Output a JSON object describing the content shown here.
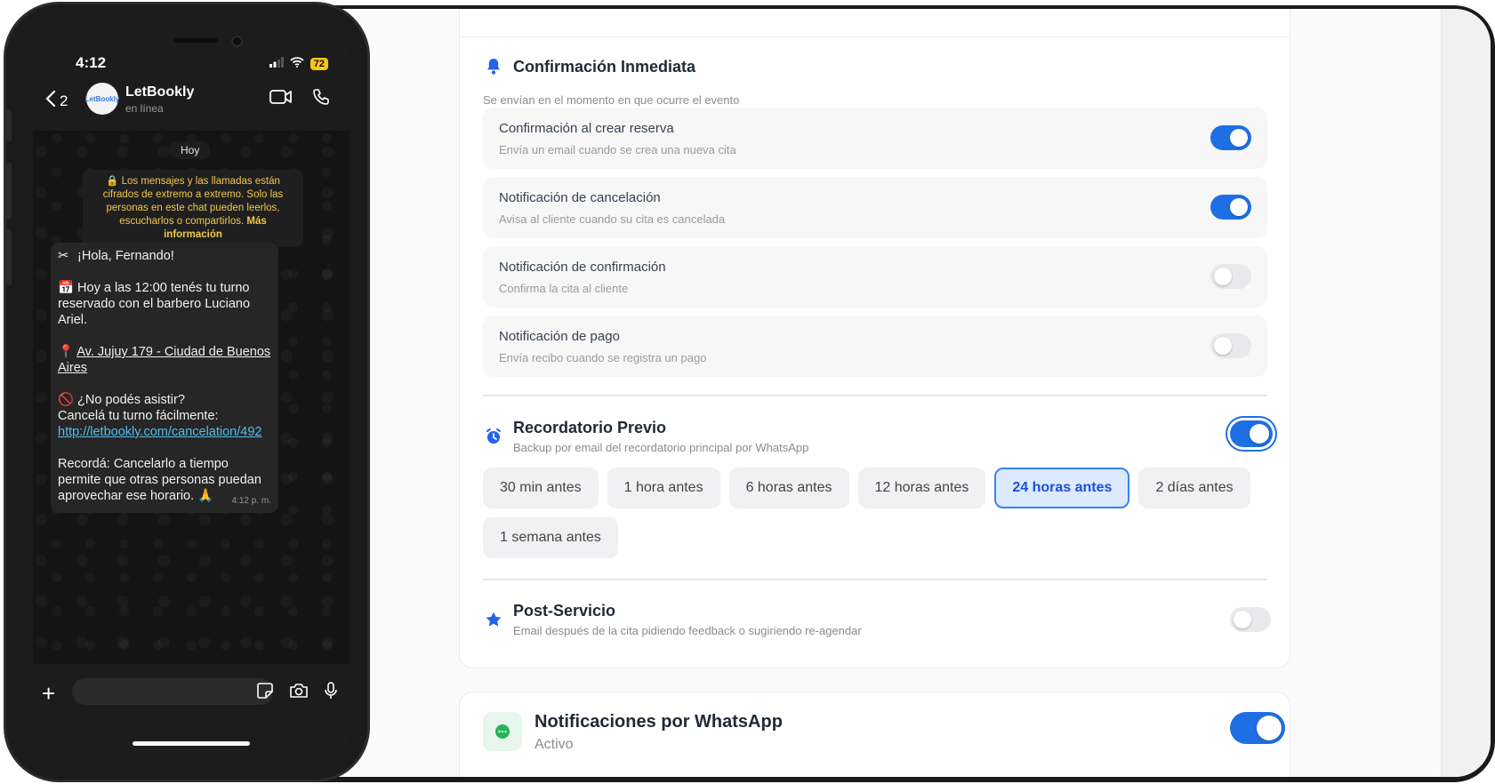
{
  "settings": {
    "immediate": {
      "title": "Confirmación Inmediata",
      "subtitle": "Se envían en el momento en que ocurre el evento",
      "icon": "bell-icon",
      "items": [
        {
          "title": "Confirmación al crear reserva",
          "subtitle": "Envía un email cuando se crea una nueva cita",
          "enabled": true
        },
        {
          "title": "Notificación de cancelación",
          "subtitle": "Avisa al cliente cuando su cita es cancelada",
          "enabled": true
        },
        {
          "title": "Notificación de confirmación",
          "subtitle": "Confirma la cita al cliente",
          "enabled": false
        },
        {
          "title": "Notificación de pago",
          "subtitle": "Envía recibo cuando se registra un pago",
          "enabled": false
        }
      ]
    },
    "reminder": {
      "title": "Recordatorio Previo",
      "subtitle": "Backup por email del recordatorio principal por WhatsApp",
      "icon": "alarm-clock-icon",
      "enabled": true,
      "options": [
        "30 min antes",
        "1 hora antes",
        "6 horas antes",
        "12 horas antes",
        "24 horas antes",
        "2 días antes",
        "1 semana antes"
      ],
      "selected": "24 horas antes"
    },
    "post": {
      "title": "Post-Servicio",
      "subtitle": "Email después de la cita pidiendo feedback o sugiriendo re-agendar",
      "icon": "star-icon",
      "enabled": false
    },
    "whatsapp": {
      "title": "Notificaciones por WhatsApp",
      "status": "Activo",
      "icon": "chat-bubble-icon",
      "enabled": true
    },
    "colors": {
      "accent": "#1e6fe3",
      "chip_selected_bg": "#dbeafe",
      "whatsapp_green": "#25b457"
    }
  },
  "phone": {
    "time": "4:12",
    "battery": "72",
    "back_count": "2",
    "contact_name": "LetBookly",
    "contact_status": "en línea",
    "avatar_text": "LetBookly",
    "day_label": "Hoy",
    "encryption_text": "Los mensajes y las llamadas están cifrados de extremo a extremo. Solo las personas en este chat pueden leerlos, escucharlos o compartirlos.",
    "encryption_link": "Más información",
    "message": {
      "greeting": "¡Hola, Fernando!",
      "appointment": "Hoy a las 12:00 tenés tu turno reservado con el barbero Luciano Ariel.",
      "address": "Av. Jujuy 179 - Ciudad de Buenos Aires",
      "cannot_attend": "¿No podés asistir?",
      "cancel_easily": "Cancelá tu turno fácilmente:",
      "cancel_link": "http://letbookly.com/cancelation/492",
      "closing": "Recordá: Cancelarlo a tiempo permite que otras personas puedan aprovechar ese horario.",
      "timestamp": "4:12 p. m."
    }
  }
}
